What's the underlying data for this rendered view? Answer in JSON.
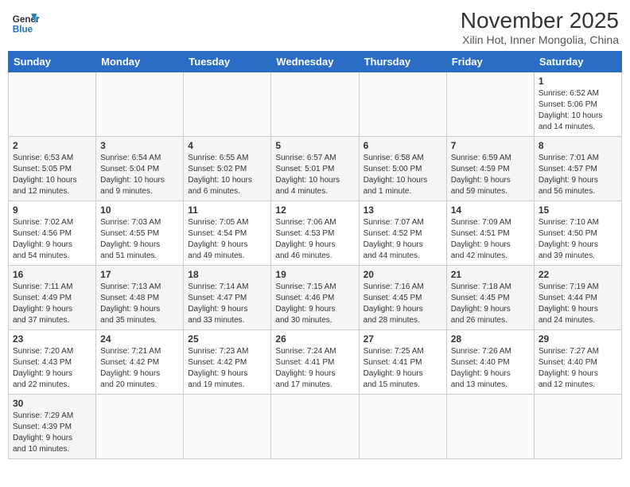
{
  "header": {
    "logo_general": "General",
    "logo_blue": "Blue",
    "month_title": "November 2025",
    "subtitle": "Xilin Hot, Inner Mongolia, China"
  },
  "days_of_week": [
    "Sunday",
    "Monday",
    "Tuesday",
    "Wednesday",
    "Thursday",
    "Friday",
    "Saturday"
  ],
  "weeks": [
    [
      {
        "day": "",
        "info": ""
      },
      {
        "day": "",
        "info": ""
      },
      {
        "day": "",
        "info": ""
      },
      {
        "day": "",
        "info": ""
      },
      {
        "day": "",
        "info": ""
      },
      {
        "day": "",
        "info": ""
      },
      {
        "day": "1",
        "info": "Sunrise: 6:52 AM\nSunset: 5:06 PM\nDaylight: 10 hours\nand 14 minutes."
      }
    ],
    [
      {
        "day": "2",
        "info": "Sunrise: 6:53 AM\nSunset: 5:05 PM\nDaylight: 10 hours\nand 12 minutes."
      },
      {
        "day": "3",
        "info": "Sunrise: 6:54 AM\nSunset: 5:04 PM\nDaylight: 10 hours\nand 9 minutes."
      },
      {
        "day": "4",
        "info": "Sunrise: 6:55 AM\nSunset: 5:02 PM\nDaylight: 10 hours\nand 6 minutes."
      },
      {
        "day": "5",
        "info": "Sunrise: 6:57 AM\nSunset: 5:01 PM\nDaylight: 10 hours\nand 4 minutes."
      },
      {
        "day": "6",
        "info": "Sunrise: 6:58 AM\nSunset: 5:00 PM\nDaylight: 10 hours\nand 1 minute."
      },
      {
        "day": "7",
        "info": "Sunrise: 6:59 AM\nSunset: 4:59 PM\nDaylight: 9 hours\nand 59 minutes."
      },
      {
        "day": "8",
        "info": "Sunrise: 7:01 AM\nSunset: 4:57 PM\nDaylight: 9 hours\nand 56 minutes."
      }
    ],
    [
      {
        "day": "9",
        "info": "Sunrise: 7:02 AM\nSunset: 4:56 PM\nDaylight: 9 hours\nand 54 minutes."
      },
      {
        "day": "10",
        "info": "Sunrise: 7:03 AM\nSunset: 4:55 PM\nDaylight: 9 hours\nand 51 minutes."
      },
      {
        "day": "11",
        "info": "Sunrise: 7:05 AM\nSunset: 4:54 PM\nDaylight: 9 hours\nand 49 minutes."
      },
      {
        "day": "12",
        "info": "Sunrise: 7:06 AM\nSunset: 4:53 PM\nDaylight: 9 hours\nand 46 minutes."
      },
      {
        "day": "13",
        "info": "Sunrise: 7:07 AM\nSunset: 4:52 PM\nDaylight: 9 hours\nand 44 minutes."
      },
      {
        "day": "14",
        "info": "Sunrise: 7:09 AM\nSunset: 4:51 PM\nDaylight: 9 hours\nand 42 minutes."
      },
      {
        "day": "15",
        "info": "Sunrise: 7:10 AM\nSunset: 4:50 PM\nDaylight: 9 hours\nand 39 minutes."
      }
    ],
    [
      {
        "day": "16",
        "info": "Sunrise: 7:11 AM\nSunset: 4:49 PM\nDaylight: 9 hours\nand 37 minutes."
      },
      {
        "day": "17",
        "info": "Sunrise: 7:13 AM\nSunset: 4:48 PM\nDaylight: 9 hours\nand 35 minutes."
      },
      {
        "day": "18",
        "info": "Sunrise: 7:14 AM\nSunset: 4:47 PM\nDaylight: 9 hours\nand 33 minutes."
      },
      {
        "day": "19",
        "info": "Sunrise: 7:15 AM\nSunset: 4:46 PM\nDaylight: 9 hours\nand 30 minutes."
      },
      {
        "day": "20",
        "info": "Sunrise: 7:16 AM\nSunset: 4:45 PM\nDaylight: 9 hours\nand 28 minutes."
      },
      {
        "day": "21",
        "info": "Sunrise: 7:18 AM\nSunset: 4:45 PM\nDaylight: 9 hours\nand 26 minutes."
      },
      {
        "day": "22",
        "info": "Sunrise: 7:19 AM\nSunset: 4:44 PM\nDaylight: 9 hours\nand 24 minutes."
      }
    ],
    [
      {
        "day": "23",
        "info": "Sunrise: 7:20 AM\nSunset: 4:43 PM\nDaylight: 9 hours\nand 22 minutes."
      },
      {
        "day": "24",
        "info": "Sunrise: 7:21 AM\nSunset: 4:42 PM\nDaylight: 9 hours\nand 20 minutes."
      },
      {
        "day": "25",
        "info": "Sunrise: 7:23 AM\nSunset: 4:42 PM\nDaylight: 9 hours\nand 19 minutes."
      },
      {
        "day": "26",
        "info": "Sunrise: 7:24 AM\nSunset: 4:41 PM\nDaylight: 9 hours\nand 17 minutes."
      },
      {
        "day": "27",
        "info": "Sunrise: 7:25 AM\nSunset: 4:41 PM\nDaylight: 9 hours\nand 15 minutes."
      },
      {
        "day": "28",
        "info": "Sunrise: 7:26 AM\nSunset: 4:40 PM\nDaylight: 9 hours\nand 13 minutes."
      },
      {
        "day": "29",
        "info": "Sunrise: 7:27 AM\nSunset: 4:40 PM\nDaylight: 9 hours\nand 12 minutes."
      }
    ],
    [
      {
        "day": "30",
        "info": "Sunrise: 7:29 AM\nSunset: 4:39 PM\nDaylight: 9 hours\nand 10 minutes."
      },
      {
        "day": "",
        "info": ""
      },
      {
        "day": "",
        "info": ""
      },
      {
        "day": "",
        "info": ""
      },
      {
        "day": "",
        "info": ""
      },
      {
        "day": "",
        "info": ""
      },
      {
        "day": "",
        "info": ""
      }
    ]
  ]
}
